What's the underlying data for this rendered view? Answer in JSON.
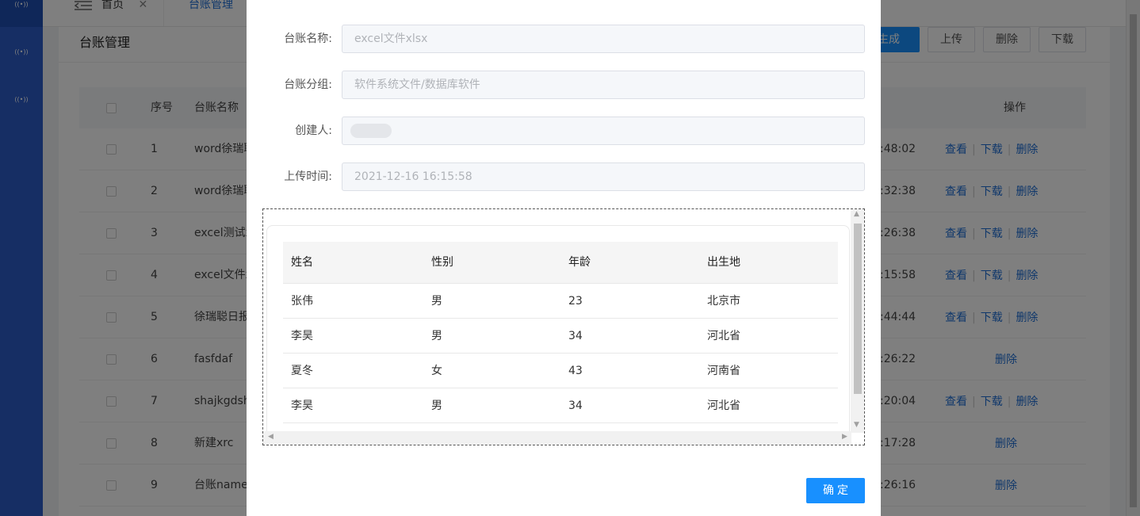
{
  "sidebar": {
    "icons": [
      "wifi-icon",
      "wifi-icon",
      "wifi-icon"
    ],
    "icon_glyph": "((•))"
  },
  "tabs": [
    {
      "label": "首页",
      "closable": true
    },
    {
      "label": "台账管理",
      "active": true
    }
  ],
  "panel": {
    "title": "台账管理",
    "buttons": [
      "生成",
      "上传",
      "删除",
      "下载"
    ]
  },
  "table": {
    "headers": {
      "index": "序号",
      "name": "台账名称",
      "actions": "操作"
    },
    "rows": [
      {
        "index": "1",
        "name": "word徐瑞聪",
        "time": ":48:02",
        "actions": [
          "查看",
          "下载",
          "删除"
        ]
      },
      {
        "index": "2",
        "name": "word徐瑞聪",
        "time": ":32:38",
        "actions": [
          "查看",
          "下载",
          "删除"
        ]
      },
      {
        "index": "3",
        "name": "excel测试x",
        "time": ":26:38",
        "actions": [
          "查看",
          "下载",
          "删除"
        ]
      },
      {
        "index": "4",
        "name": "excel文件x",
        "time": ":15:58",
        "actions": [
          "查看",
          "下载",
          "删除"
        ]
      },
      {
        "index": "5",
        "name": "徐瑞聪日报",
        "time": ":44:44",
        "actions": [
          "查看",
          "下载",
          "删除"
        ]
      },
      {
        "index": "6",
        "name": "fasfdaf",
        "time": ":26:22",
        "actions": [
          "删除"
        ]
      },
      {
        "index": "7",
        "name": "shajkgdsh",
        "time": ":20:04",
        "actions": [
          "查看",
          "下载",
          "删除"
        ]
      },
      {
        "index": "8",
        "name": "新建xrc",
        "time": ":17:28",
        "actions": [
          "删除"
        ]
      },
      {
        "index": "9",
        "name": "台账name",
        "time": ":26:16",
        "actions": [
          "删除"
        ]
      }
    ]
  },
  "modal": {
    "fields": [
      {
        "label": "台账名称:",
        "value": "excel文件xlsx"
      },
      {
        "label": "台账分组:",
        "value": "软件系统文件/数据库软件"
      },
      {
        "label": "创建人:",
        "value": ""
      },
      {
        "label": "上传时间:",
        "value": "2021-12-16 16:15:58"
      }
    ],
    "preview": {
      "headers": [
        "姓名",
        "性别",
        "年龄",
        "出生地"
      ],
      "rows": [
        [
          "张伟",
          "男",
          "23",
          "北京市"
        ],
        [
          "李昊",
          "男",
          "34",
          "河北省"
        ],
        [
          "夏冬",
          "女",
          "43",
          "河南省"
        ],
        [
          "李昊",
          "男",
          "34",
          "河北省"
        ]
      ]
    },
    "confirm_label": "确定"
  },
  "colors": {
    "primary": "#1890ff",
    "link": "#1f6fd6",
    "sidebar": "#2c5cc8"
  }
}
